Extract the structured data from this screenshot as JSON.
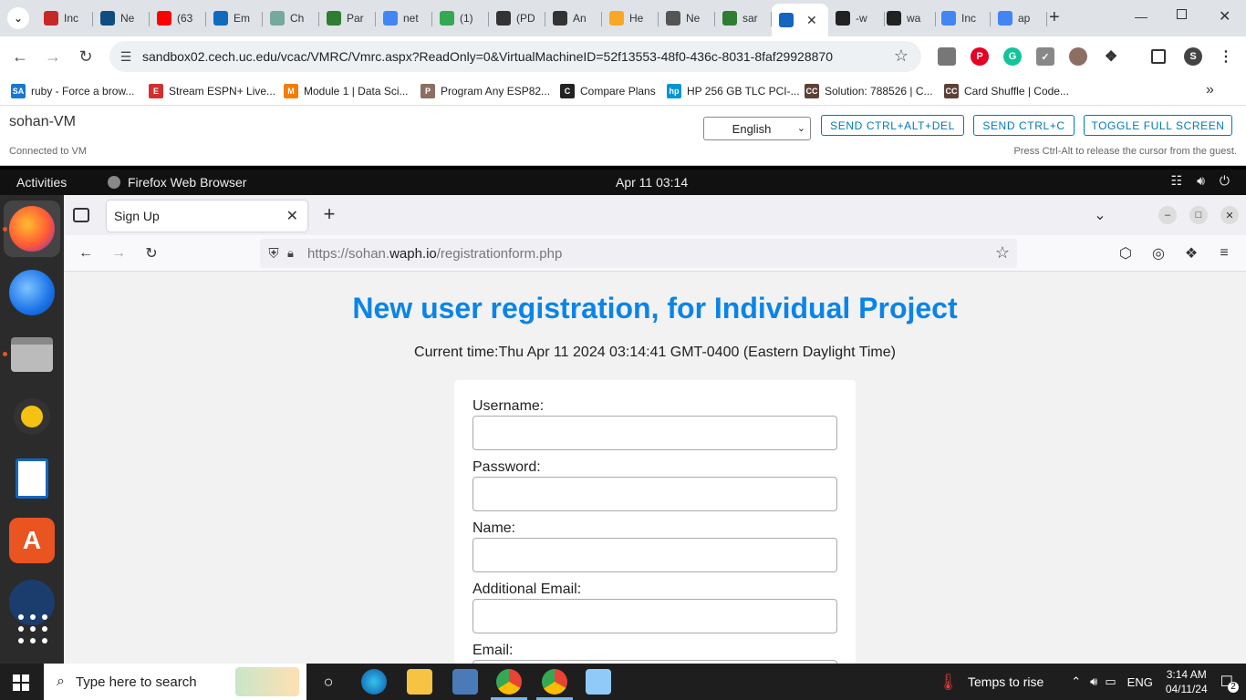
{
  "chrome": {
    "tabs": [
      {
        "label": "Inc",
        "icon": "wolf-icon",
        "color": "#c62828"
      },
      {
        "label": "Ne",
        "icon": "video-icon",
        "color": "#0f4c81"
      },
      {
        "label": "(63",
        "icon": "youtube-icon",
        "color": "#ff0000"
      },
      {
        "label": "Em",
        "icon": "outlook-icon",
        "color": "#0f6cbd"
      },
      {
        "label": "Ch",
        "icon": "chatgpt-icon",
        "color": "#74aa9c"
      },
      {
        "label": "Par",
        "icon": "paraphrase-icon",
        "color": "#2e7d32"
      },
      {
        "label": "net",
        "icon": "google-icon",
        "color": "#4285f4"
      },
      {
        "label": "(1)",
        "icon": "loading-icon",
        "color": "#34a853"
      },
      {
        "label": "(PD",
        "icon": "researchgate-icon",
        "color": "#333333"
      },
      {
        "label": "An",
        "icon": "researchgate-icon",
        "color": "#333333"
      },
      {
        "label": "He",
        "icon": "chart-icon",
        "color": "#f9a825"
      },
      {
        "label": "Ne",
        "icon": "globe-icon",
        "color": "#555555"
      },
      {
        "label": "sar",
        "icon": "globe-icon",
        "color": "#2e7d32"
      },
      {
        "label": "",
        "icon": "monitor-icon",
        "color": "#1565c0"
      },
      {
        "label": "-w",
        "icon": "github-icon",
        "color": "#222222"
      },
      {
        "label": "wa",
        "icon": "github-icon",
        "color": "#222222"
      },
      {
        "label": "Inc",
        "icon": "google-icon",
        "color": "#4285f4"
      },
      {
        "label": "ap",
        "icon": "google-icon",
        "color": "#4285f4"
      }
    ],
    "url": "sandbox02.cech.uc.edu/vcac/VMRC/Vmrc.aspx?ReadOnly=0&VirtualMachineID=52f13553-48f0-436c-8031-8faf29928870",
    "profile_initial": "S",
    "bookmarks": [
      {
        "label": "ruby - Force a brow...",
        "color": "#1976d2",
        "glyph": "SA"
      },
      {
        "label": "Stream ESPN+ Live...",
        "color": "#d32f2f",
        "glyph": "E"
      },
      {
        "label": "Module 1 | Data Sci...",
        "color": "#f57c00",
        "glyph": "M"
      },
      {
        "label": "Program Any ESP82...",
        "color": "#8d6e63",
        "glyph": "P"
      },
      {
        "label": "Compare Plans",
        "color": "#222222",
        "glyph": "C"
      },
      {
        "label": "HP 256 GB TLC PCI-...",
        "color": "#0096d6",
        "glyph": "hp"
      },
      {
        "label": "Solution: 788526 | C...",
        "color": "#5d4037",
        "glyph": "CC"
      },
      {
        "label": "Card Shuffle | Code...",
        "color": "#5d4037",
        "glyph": "CC"
      }
    ]
  },
  "vmrc": {
    "title": "sohan-VM",
    "status": "Connected to VM",
    "language": "English",
    "buttons": [
      "SEND CTRL+ALT+DEL",
      "SEND CTRL+C",
      "TOGGLE FULL SCREEN"
    ],
    "hint": "Press Ctrl-Alt to release the cursor from the guest."
  },
  "gnome": {
    "activities": "Activities",
    "app_name": "Firefox Web Browser",
    "clock": "Apr 11  03:14"
  },
  "firefox": {
    "tab_title": "Sign Up",
    "url_prefix": "https://sohan.",
    "url_domain": "waph.io",
    "url_path": "/registrationform.php"
  },
  "page": {
    "heading": "New user registration, for Individual Project",
    "time_line": "Current time:Thu Apr 11 2024 03:14:41 GMT-0400 (Eastern Daylight Time)",
    "fields": [
      {
        "label": "Username:",
        "value": ""
      },
      {
        "label": "Password:",
        "value": ""
      },
      {
        "label": "Name:",
        "value": ""
      },
      {
        "label": "Additional Email:",
        "value": ""
      },
      {
        "label": "Email:",
        "value": ""
      }
    ]
  },
  "taskbar": {
    "search_placeholder": "Type here to search",
    "weather": "Temps to rise",
    "lang": "ENG",
    "time": "3:14 AM",
    "date": "04/11/24",
    "notifications": "2"
  },
  "colors": {
    "heading": "#0a84e8",
    "vm_button": "#0079b8"
  }
}
